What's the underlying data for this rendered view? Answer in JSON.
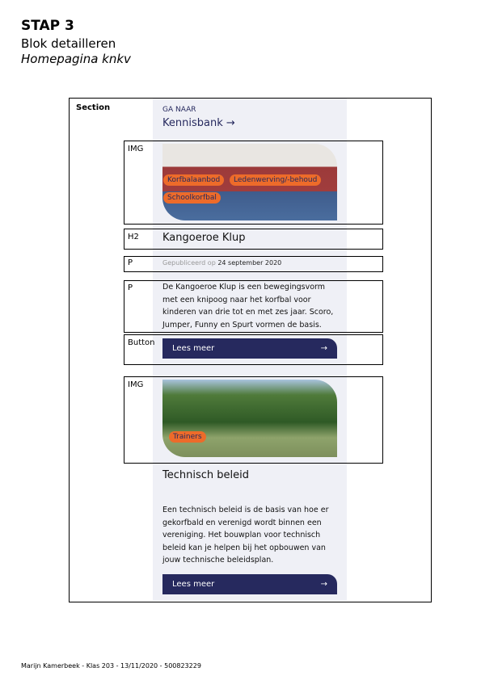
{
  "header": {
    "title": "STAP 3",
    "subtitle": "Blok detailleren",
    "page": "Homepagina knkv"
  },
  "labels": {
    "section": "Section",
    "img": "IMG",
    "h2": "H2",
    "p": "P",
    "button": "Button"
  },
  "goto": {
    "label": "GA NAAR",
    "link": "Kennisbank →"
  },
  "card1": {
    "tags": [
      "Korfbalaanbod",
      "Ledenwerving/-behoud",
      "Schoolkorfbal"
    ],
    "title": "Kangoeroe Klup",
    "published_label": "Gepubliceerd op",
    "published_date": "24 september 2020",
    "text": "De Kangoeroe Klup is een bewegingsvorm met een knipoog naar het korfbal voor kinderen van drie tot en met zes jaar. Scoro, Jumper, Funny en Spurt vormen de basis.",
    "button": "Lees meer",
    "arrow": "→"
  },
  "card2": {
    "tags": [
      "Trainers"
    ],
    "title": "Technisch beleid",
    "text": "Een technisch beleid is de basis van hoe er gekorfbald en verenigd wordt binnen een vereniging. Het bouwplan voor technisch beleid kan je helpen bij het opbouwen van jouw technische beleidsplan.",
    "button": "Lees meer",
    "arrow": "→"
  },
  "footer": "Marijn Kamerbeek - Klas 203 - 13/11/2020 - 500823229"
}
